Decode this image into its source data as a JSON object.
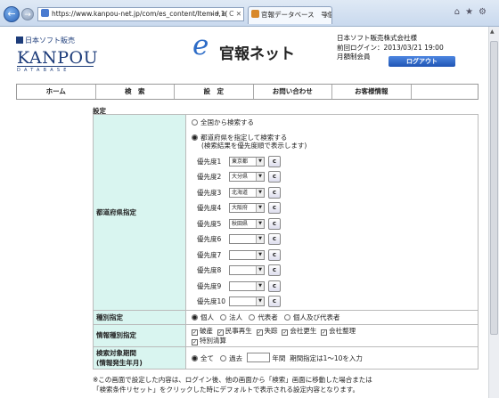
{
  "browser": {
    "url": "https://www.kanpou-net.jp/com/es_content/Itemid,1(",
    "tab_title": "官報データベース　号個..."
  },
  "site": {
    "logo_company": "日本ソフト販売",
    "logo_kanpou": "KANPOU",
    "logo_sub": "DATABASE",
    "logo_e": "e",
    "site_name": "官報ネット"
  },
  "user": {
    "company": "日本ソフト販売株式会社様",
    "last_login": "前回ログイン：2013/03/21 19:00",
    "plan": "月額制会員",
    "logout": "ログアウト"
  },
  "menu": [
    {
      "label": "ホーム"
    },
    {
      "label": "検　索"
    },
    {
      "label": "設　定"
    },
    {
      "label": "お問い合わせ"
    },
    {
      "label": "お客様情報"
    },
    {
      "label": ""
    }
  ],
  "settings": {
    "section_title": "設定",
    "region": {
      "label": "都道府県指定",
      "option_all": "全国から検索する",
      "option_specify": "都道府県を指定して検索する",
      "option_specify_note": "(検索結果を優先度順で表示します)",
      "priorities": [
        {
          "label": "優先度1",
          "value": "東京都"
        },
        {
          "label": "優先度2",
          "value": "大分県"
        },
        {
          "label": "優先度3",
          "value": "北海道"
        },
        {
          "label": "優先度4",
          "value": "大阪府"
        },
        {
          "label": "優先度5",
          "value": "秋田県"
        },
        {
          "label": "優先度6",
          "value": ""
        },
        {
          "label": "優先度7",
          "value": ""
        },
        {
          "label": "優先度8",
          "value": ""
        },
        {
          "label": "優先度9",
          "value": ""
        },
        {
          "label": "優先度10",
          "value": ""
        }
      ],
      "clear_button": "c"
    },
    "type": {
      "label": "種別指定",
      "options": [
        "個人",
        "法人",
        "代表者",
        "個人及び代表者"
      ]
    },
    "info": {
      "label": "情報種別指定",
      "options": [
        "破産",
        "民事再生",
        "失踪",
        "会社更生",
        "会社整理",
        "特別清算"
      ]
    },
    "period": {
      "label1": "検索対象期間",
      "label2": "(情報発生年月)",
      "opt_all": "全て",
      "opt_past": "過去",
      "unit": "年間",
      "note": "期間指定は1〜10を入力"
    }
  },
  "note": {
    "line1": "※この画面で設定した内容は、ログイン後、他の画面から「検索」画面に移動した場合または",
    "line2": "「検索条件リセット」をクリックした時にデフォルトで表示される設定内容となります。"
  }
}
